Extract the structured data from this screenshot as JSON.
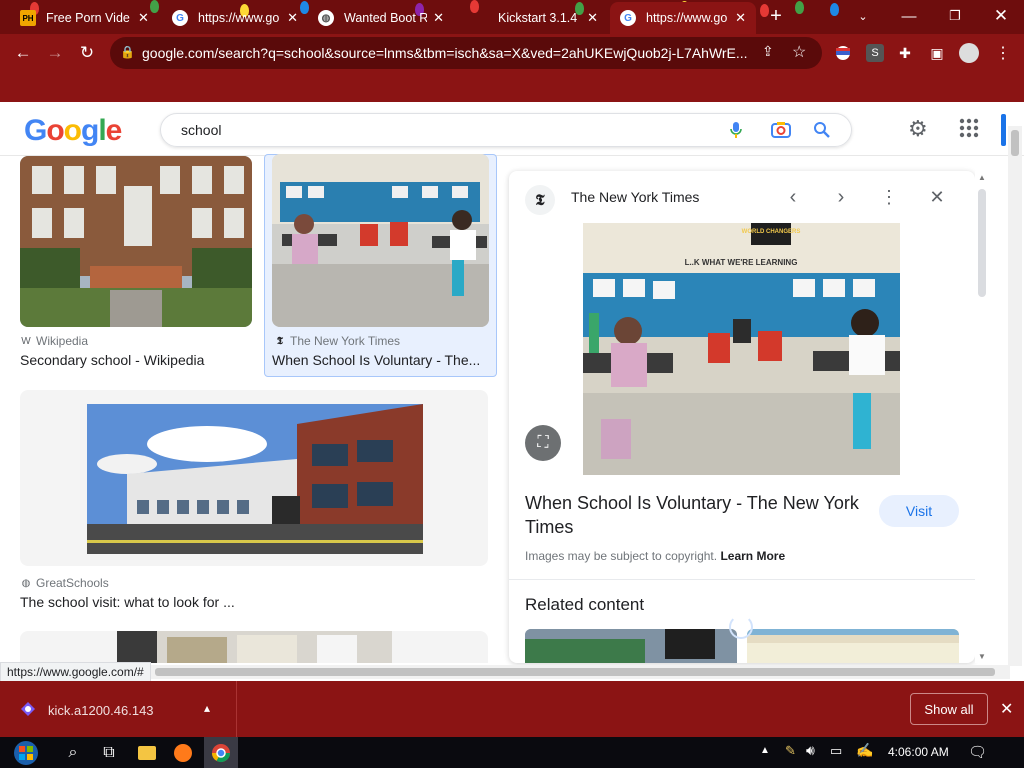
{
  "browser": {
    "tabs": [
      {
        "title": "Free Porn Vide",
        "icon": "ph-favicon",
        "active": false
      },
      {
        "title": "https://www.go",
        "icon": "google-favicon",
        "active": false
      },
      {
        "title": "Wanted Boot R",
        "icon": "globe-favicon",
        "active": false
      },
      {
        "title": "Kickstart 3.1.4",
        "icon": "kickstart-favicon",
        "active": false
      },
      {
        "title": "https://www.go",
        "icon": "google-favicon",
        "active": true
      }
    ],
    "url": "google.com/search?q=school&source=lnms&tbm=isch&sa=X&ved=2ahUKEwjQuob2j-L7AhWrE...",
    "profile_letter": "S"
  },
  "google": {
    "logo_letters": [
      "G",
      "o",
      "o",
      "g",
      "l",
      "e"
    ],
    "query": "school"
  },
  "results": [
    {
      "source": "Wikipedia",
      "title": "Secondary school - Wikipedia",
      "icon": "wikipedia-icon"
    },
    {
      "source": "The New York Times",
      "title": "When School Is Voluntary - The...",
      "icon": "nyt-icon"
    },
    {
      "source": "GreatSchools",
      "title": "The school visit: what to look for ...",
      "icon": "globe-icon"
    }
  ],
  "preview": {
    "source": "The New York Times",
    "banner_text": "WORLD CHANGERS",
    "board_text": "L..K WHAT WE'RE LEARNING",
    "title": "When School Is Voluntary - The New York Times",
    "visit_label": "Visit",
    "copyright": "Images may be subject to copyright.",
    "learn_more": "Learn More",
    "related_heading": "Related content"
  },
  "status_url": "https://www.google.com/#",
  "download": {
    "filename": "kick.a1200.46.143",
    "show_all": "Show all"
  },
  "taskbar": {
    "time": "4:06:00 AM"
  },
  "colors": {
    "chrome_frame": "#6e0d0d",
    "chrome_toolbar": "#8b1414",
    "google_blue": "#4285f4",
    "google_red": "#ea4335",
    "google_yellow": "#fbbc05",
    "google_green": "#34a853",
    "link_blue": "#1a73e8"
  }
}
